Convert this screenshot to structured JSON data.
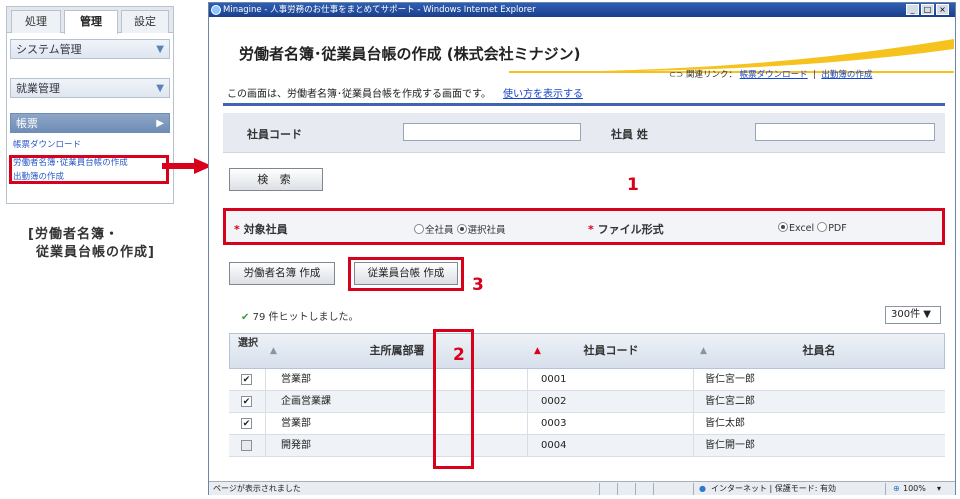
{
  "menu": {
    "tabs": [
      "処理",
      "管理",
      "設定"
    ],
    "sections": [
      "システム管理",
      "就業管理",
      "帳票"
    ],
    "sub_items": [
      "帳票ダウンロード",
      "労働者名簿･従業員台帳の作成",
      "出勤簿の作成"
    ],
    "caption_line1": "[労働者名簿・",
    "caption_line2": "従業員台帳の作成]"
  },
  "window": {
    "title": "Minagine - 人事労務のお仕事をまとめてサポート - Windows Internet Explorer",
    "controls": [
      "_",
      "□",
      "×"
    ]
  },
  "page": {
    "title": "労働者名簿･従業員台帳の作成 (株式会社ミナジン)",
    "description": "この画面は、労働者名簿･従業員台帳を作成する画面です。",
    "howto_link": "使い方を表示する",
    "related_label": "関連リンク：",
    "related_links": [
      "帳票ダウンロード",
      "出勤簿の作成"
    ],
    "related_sep": "|"
  },
  "search": {
    "employee_code_label": "社員コード",
    "last_name_label": "社員 姓",
    "employee_code_value": "",
    "last_name_value": "",
    "button": "検 索"
  },
  "options": {
    "target_label": "対象社員",
    "target_choices": [
      "全社員",
      "選択社員"
    ],
    "target_selected": "選択社員",
    "format_label": "ファイル形式",
    "format_choices": [
      "Excel",
      "PDF"
    ],
    "format_selected": "Excel",
    "required_mark": "*"
  },
  "annotations": [
    "1",
    "2",
    "3"
  ],
  "actions": {
    "roster_button": "労働者名簿 作成",
    "ledger_button": "従業員台帳 作成"
  },
  "results": {
    "hits_text": "79 件ヒットしました。",
    "per_page": "300件 ▼"
  },
  "table": {
    "headers": [
      "選択",
      "主所属部署",
      "社員コード",
      "社員名"
    ],
    "rows": [
      {
        "checked": true,
        "dept": "営業部",
        "code": "0001",
        "name": "皆仁宮一郎"
      },
      {
        "checked": true,
        "dept": "企画営業課",
        "code": "0002",
        "name": "皆仁宮二郎"
      },
      {
        "checked": true,
        "dept": "営業部",
        "code": "0003",
        "name": "皆仁太郎"
      },
      {
        "checked": false,
        "dept": "開発部",
        "code": "0004",
        "name": "皆仁開一郎"
      }
    ]
  },
  "statusbar": {
    "left": "ページが表示されました",
    "zone": "インターネット | 保護モード: 有効",
    "zoom": "100%"
  },
  "colors": {
    "accent_red": "#d8001a",
    "nav_blue": "#3f64b0",
    "link_blue": "#1846c8",
    "swoosh_yellow": "#f6c21e"
  }
}
